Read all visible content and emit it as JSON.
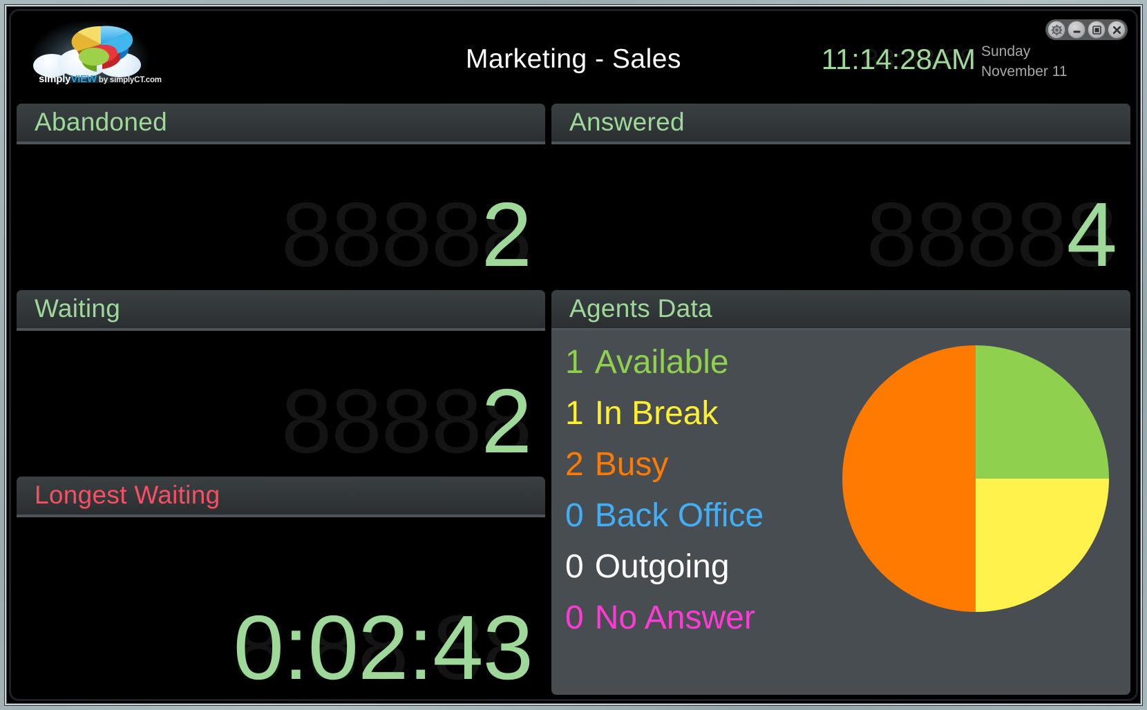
{
  "window": {
    "controls": [
      {
        "name": "settings",
        "label": "Settings",
        "icon": "gear-icon"
      },
      {
        "name": "minimize",
        "label": "Minimize",
        "icon": "minimize-icon"
      },
      {
        "name": "maximize",
        "label": "Maximize",
        "icon": "maximize-icon"
      },
      {
        "name": "close",
        "label": "Close",
        "icon": "close-icon"
      }
    ]
  },
  "header": {
    "logo": {
      "word_simply": "simply",
      "word_view": "VIEW",
      "word_by": " by simplyCT.com",
      "icon": "cloud-pie-chart-logo"
    },
    "title": "Marketing - Sales",
    "clock": {
      "value": "11:14:28AM",
      "ghost": "88:88:88",
      "color": "#9ed99a"
    },
    "date": {
      "weekday": "Sunday",
      "monthday": "November 11"
    }
  },
  "panels": {
    "abandoned": {
      "title": "Abandoned",
      "title_color": "#9ed99a",
      "value": "2",
      "ghost": "88888",
      "value_color": "#9ed99a"
    },
    "waiting": {
      "title": "Waiting",
      "title_color": "#9ed99a",
      "value": "2",
      "ghost": "88888",
      "value_color": "#9ed99a"
    },
    "longest_waiting": {
      "title": "Longest Waiting",
      "title_color": "#fb4e60",
      "value": "0:02:43",
      "ghost": "8:88:88",
      "value_color": "#9ed99a"
    },
    "answered": {
      "title": "Answered",
      "title_color": "#9ed99a",
      "value": "4",
      "ghost": "88888",
      "value_color": "#9ed99a"
    },
    "agents": {
      "title": "Agents Data",
      "title_color": "#9ed99a",
      "rows": [
        {
          "count": "1",
          "label": "Available",
          "color": "#8fd14f"
        },
        {
          "count": "1",
          "label": "In Break",
          "color": "#ffef33"
        },
        {
          "count": "2",
          "label": "Busy",
          "color": "#ff7a00"
        },
        {
          "count": "0",
          "label": "Back Office",
          "color": "#42aef5"
        },
        {
          "count": "0",
          "label": "Outgoing",
          "color": "#ffffff"
        },
        {
          "count": "0",
          "label": "No Answer",
          "color": "#ff3ad6"
        }
      ]
    }
  },
  "chart_data": {
    "type": "pie",
    "title": "Agents Data",
    "categories": [
      "Available",
      "In Break",
      "Busy",
      "Back Office",
      "Outgoing",
      "No Answer"
    ],
    "values": [
      1,
      1,
      2,
      0,
      0,
      0
    ],
    "percentages": [
      25,
      25,
      50,
      0,
      0,
      0
    ],
    "colors": [
      "#8fd14f",
      "#ffef33",
      "#ff7a00",
      "#42aef5",
      "#ffffff",
      "#ff3ad6"
    ],
    "legend_position": "left",
    "start_angle_deg": 0,
    "direction": "clockwise",
    "total": 4
  }
}
